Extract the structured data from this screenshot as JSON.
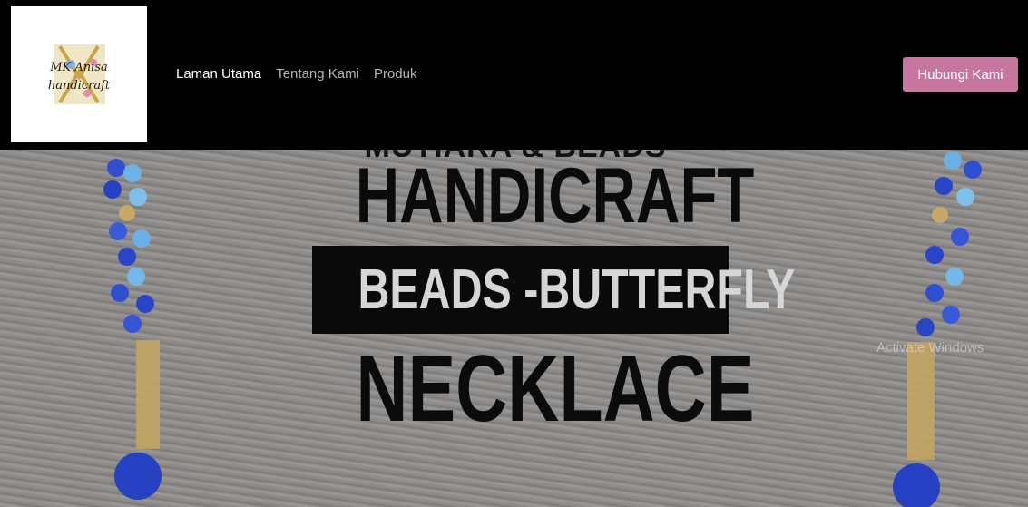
{
  "header": {
    "logo": {
      "icon": "mk-anisa-handicraft-logo",
      "line1": "MK Anisa",
      "line2": "handicraft"
    },
    "nav": [
      {
        "label": "Laman Utama",
        "active": true
      },
      {
        "label": "Tentang Kami",
        "active": false
      },
      {
        "label": "Produk",
        "active": false
      }
    ],
    "cta_label": "Hubungi Kami",
    "colors": {
      "background": "#000000",
      "cta": "#c7779f",
      "nav_active": "#ffffff",
      "nav_inactive": "#b5b5b5"
    }
  },
  "hero": {
    "cut_line": "MUTIARA & BEADS",
    "line1": "HANDICRAFT",
    "line2": "BEADS -BUTTERFLY",
    "line3": "NECKLACE"
  },
  "watermark": "Activate Windows"
}
